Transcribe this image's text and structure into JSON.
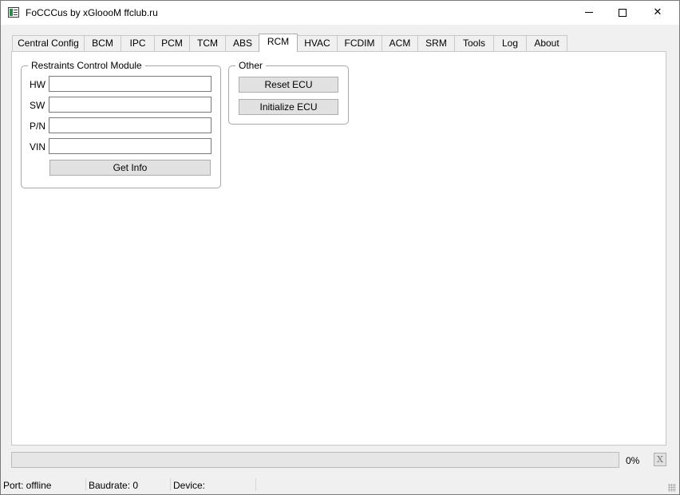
{
  "window": {
    "title": "FoCCCus by xGloooM ffclub.ru",
    "controls": {
      "minimize": "",
      "maximize": "",
      "close": "✕"
    }
  },
  "tabs": [
    {
      "label": "Central Config"
    },
    {
      "label": "BCM"
    },
    {
      "label": "IPC"
    },
    {
      "label": "PCM"
    },
    {
      "label": "TCM"
    },
    {
      "label": "ABS"
    },
    {
      "label": "RCM",
      "active": true
    },
    {
      "label": "HVAC"
    },
    {
      "label": "FCDIM"
    },
    {
      "label": "ACM"
    },
    {
      "label": "SRM"
    },
    {
      "label": "Tools"
    },
    {
      "label": "Log"
    },
    {
      "label": "About"
    }
  ],
  "rcm_group": {
    "title": "Restraints Control Module",
    "fields": [
      {
        "label": "HW",
        "value": ""
      },
      {
        "label": "SW",
        "value": ""
      },
      {
        "label": "P/N",
        "value": ""
      },
      {
        "label": "VIN",
        "value": ""
      }
    ],
    "get_info_label": "Get Info"
  },
  "other_group": {
    "title": "Other",
    "reset_label": "Reset ECU",
    "initialize_label": "Initialize ECU"
  },
  "progress": {
    "value_percent": 0,
    "text": "0%",
    "cancel_label": "X",
    "fill_color": "#06b025"
  },
  "statusbar": {
    "port": "Port: offline",
    "baudrate": "Baudrate: 0",
    "device": "Device:"
  }
}
